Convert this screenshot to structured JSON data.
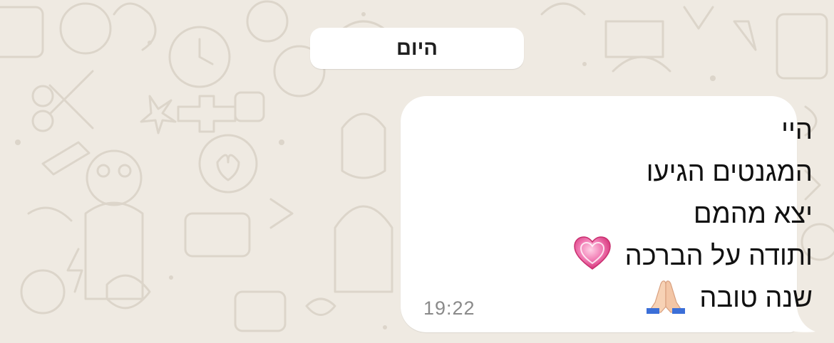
{
  "chat": {
    "date_label": "היום",
    "message": {
      "lines": [
        "היי",
        "המגנטים הגיעו",
        "יצא מהמם",
        "ותודה על הברכה",
        "שנה טובה"
      ],
      "emojis": {
        "heart": "💗",
        "pray": "🙏🏻"
      },
      "time": "19:22"
    }
  },
  "colors": {
    "wallpaper": "#efeae2",
    "wallpaper_doodle": "#dcd5ca",
    "bubble": "#ffffff",
    "timestamp": "#8a8a8a",
    "heart": "#e84a8a"
  }
}
